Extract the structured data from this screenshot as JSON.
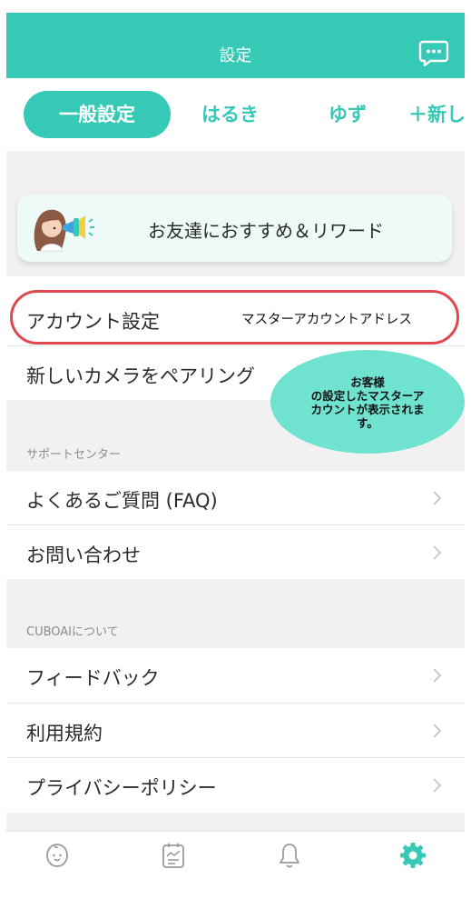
{
  "colors": {
    "accent": "#36c9b6",
    "annotation_border": "#e0484e",
    "bubble": "#6fe3d0"
  },
  "header": {
    "title": "設定",
    "chat_icon": "chat-bubble-icon"
  },
  "tabs": [
    {
      "label": "一般設定",
      "active": true
    },
    {
      "label": "はるき",
      "active": false
    },
    {
      "label": "ゆず",
      "active": false
    },
    {
      "label": "＋新し",
      "active": false
    }
  ],
  "promo": {
    "label": "お友達におすすめ＆リワード",
    "icon": "girl-megaphone-icon"
  },
  "account": {
    "items": [
      {
        "label": "アカウント設定"
      },
      {
        "label": "新しいカメラをペアリング"
      }
    ]
  },
  "annotation": {
    "email_label": "マスターアカウントアドレス",
    "bubble_text": "お客様\nの設定したマスターア\nカウントが表示されま\nす。"
  },
  "support": {
    "header": "サポートセンター",
    "items": [
      {
        "label": "よくあるご質問 (FAQ)"
      },
      {
        "label": "お問い合わせ"
      }
    ]
  },
  "about": {
    "header": "CUBOAIについて",
    "items": [
      {
        "label": "フィードバック"
      },
      {
        "label": "利用規約"
      },
      {
        "label": "プライバシーポリシー"
      }
    ]
  },
  "bottom_nav": [
    {
      "icon": "baby-face-icon",
      "active": false
    },
    {
      "icon": "report-icon",
      "active": false
    },
    {
      "icon": "bell-icon",
      "active": false
    },
    {
      "icon": "gear-icon",
      "active": true
    }
  ]
}
